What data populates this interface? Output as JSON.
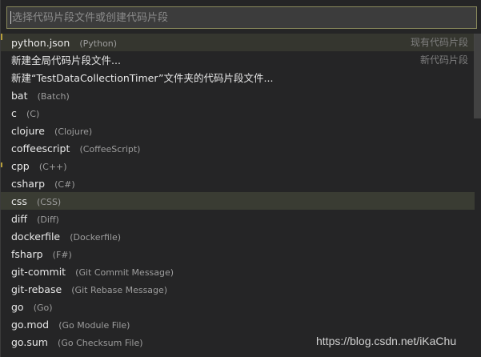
{
  "filter": {
    "placeholder": "选择代码片段文件或创建代码片段"
  },
  "items": [
    {
      "label": "python.json",
      "desc": "(Python)",
      "detail": "现有代码片段"
    },
    {
      "label": "新建全局代码片段文件...",
      "desc": "",
      "detail": "新代码片段"
    },
    {
      "label": "新建“TestDataCollectionTimer”文件夹的代码片段文件...",
      "desc": "",
      "detail": ""
    },
    {
      "label": "bat",
      "desc": "(Batch)",
      "detail": ""
    },
    {
      "label": "c",
      "desc": "(C)",
      "detail": ""
    },
    {
      "label": "clojure",
      "desc": "(Clojure)",
      "detail": ""
    },
    {
      "label": "coffeescript",
      "desc": "(CoffeeScript)",
      "detail": ""
    },
    {
      "label": "cpp",
      "desc": "(C++)",
      "detail": ""
    },
    {
      "label": "csharp",
      "desc": "(C#)",
      "detail": ""
    },
    {
      "label": "css",
      "desc": "(CSS)",
      "detail": ""
    },
    {
      "label": "diff",
      "desc": "(Diff)",
      "detail": ""
    },
    {
      "label": "dockerfile",
      "desc": "(Dockerfile)",
      "detail": ""
    },
    {
      "label": "fsharp",
      "desc": "(F#)",
      "detail": ""
    },
    {
      "label": "git-commit",
      "desc": "(Git Commit Message)",
      "detail": ""
    },
    {
      "label": "git-rebase",
      "desc": "(Git Rebase Message)",
      "detail": ""
    },
    {
      "label": "go",
      "desc": "(Go)",
      "detail": ""
    },
    {
      "label": "go.mod",
      "desc": "(Go Module File)",
      "detail": ""
    },
    {
      "label": "go.sum",
      "desc": "(Go Checksum File)",
      "detail": ""
    }
  ],
  "watermark": "https://blog.csdn.net/iKaChu",
  "colors": {
    "background": "#252526",
    "active_row": "#35362f",
    "focused_row": "#3a3c33",
    "input_border": "#8a8a5c"
  }
}
